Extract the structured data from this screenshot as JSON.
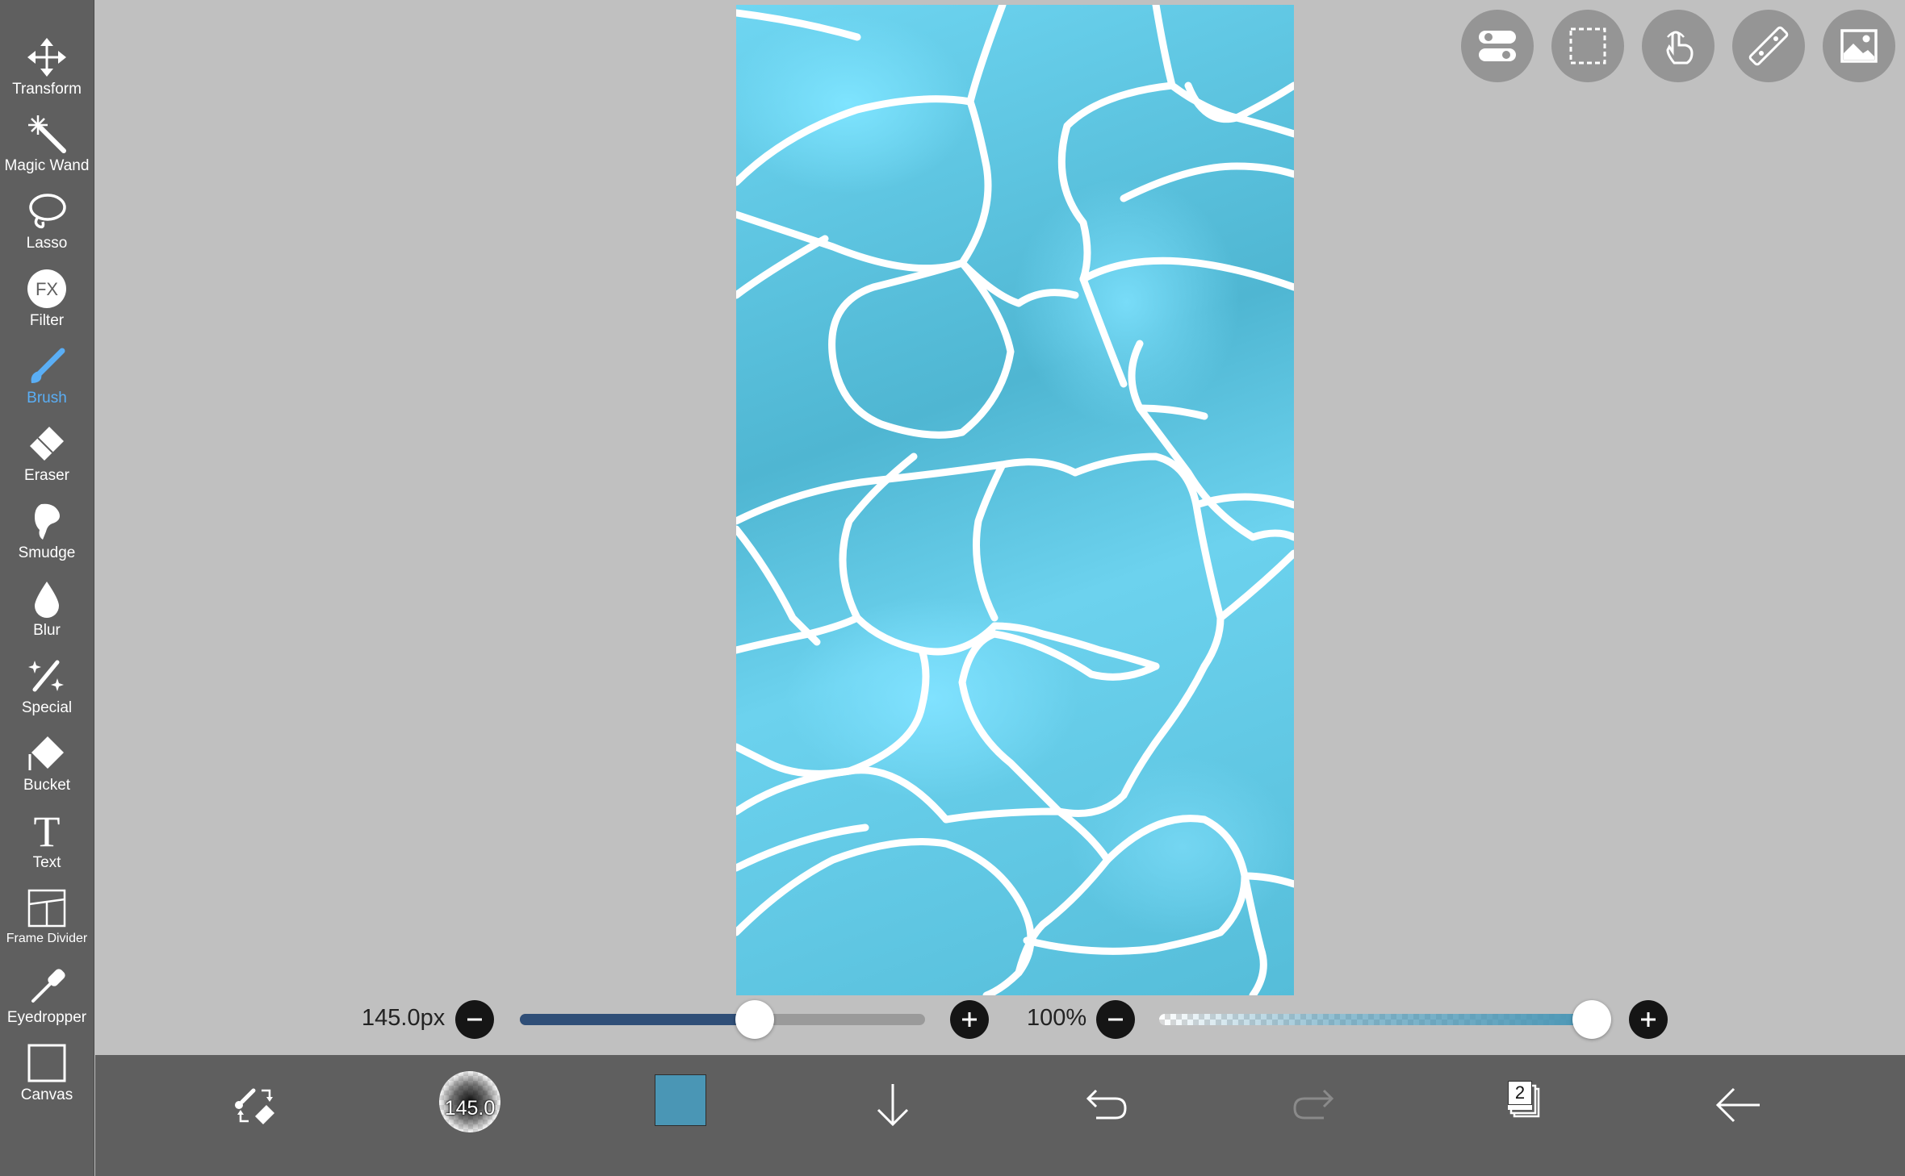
{
  "toolbar": {
    "items": [
      {
        "label": "Transform",
        "icon": "move-arrows-icon"
      },
      {
        "label": "Magic Wand",
        "icon": "magic-wand-icon"
      },
      {
        "label": "Lasso",
        "icon": "lasso-icon"
      },
      {
        "label": "Filter",
        "icon": "fx-filter-icon",
        "glyph": "FX"
      },
      {
        "label": "Brush",
        "icon": "brush-icon",
        "active": true
      },
      {
        "label": "Eraser",
        "icon": "eraser-icon"
      },
      {
        "label": "Smudge",
        "icon": "smudge-icon"
      },
      {
        "label": "Blur",
        "icon": "blur-drop-icon"
      },
      {
        "label": "Special",
        "icon": "special-sparkle-icon"
      },
      {
        "label": "Bucket",
        "icon": "bucket-icon"
      },
      {
        "label": "Text",
        "icon": "text-icon",
        "glyph": "T"
      },
      {
        "label": "Frame Divider",
        "icon": "frame-divider-icon"
      },
      {
        "label": "Eyedropper",
        "icon": "eyedropper-icon"
      },
      {
        "label": "Canvas",
        "icon": "canvas-icon"
      }
    ],
    "active_color": "#5aaef5"
  },
  "top_buttons": [
    {
      "icon": "toggle-settings-icon"
    },
    {
      "icon": "selection-rect-icon"
    },
    {
      "icon": "touch-hand-icon"
    },
    {
      "icon": "ruler-icon"
    },
    {
      "icon": "image-icon"
    }
  ],
  "brush_size": {
    "value_label": "145.0px",
    "level": 0.58,
    "fill_color": "#2f4e77"
  },
  "opacity": {
    "value_label": "100%",
    "level": 1.0,
    "fill_color": "#4a96b5"
  },
  "bottom_bar": {
    "brush_preview_label": "145.0",
    "current_color": "#4a96b5",
    "layer_count": "2"
  },
  "colors": {
    "toolbar_bg": "#5f5f5f",
    "workspace_bg": "#c0c0c0",
    "canvas_water": "#6fd6f2"
  }
}
